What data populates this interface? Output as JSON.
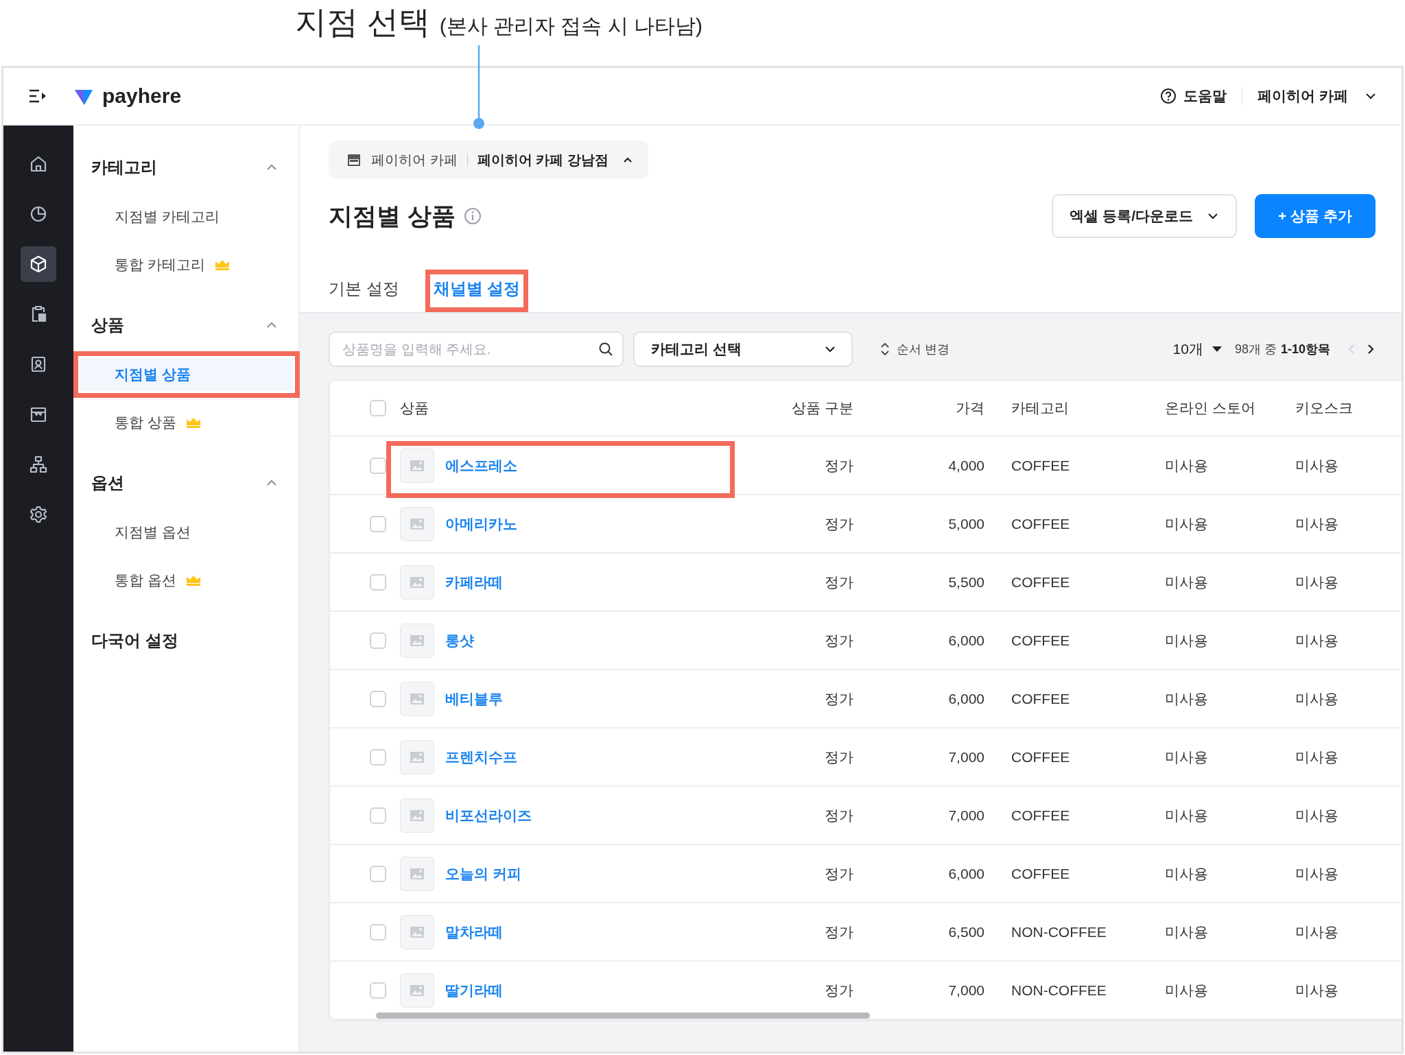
{
  "annotation": {
    "title": "지점 선택",
    "note": "(본사 관리자 접속 시 나타남)"
  },
  "header": {
    "logo": "payhere",
    "help": "도움말",
    "account": "페이히어 카페"
  },
  "rail": [
    {
      "kind": "home",
      "selected": false
    },
    {
      "kind": "chart",
      "selected": false
    },
    {
      "kind": "cube",
      "selected": true
    },
    {
      "kind": "clipboard",
      "selected": false
    },
    {
      "kind": "contact",
      "selected": false
    },
    {
      "kind": "store",
      "selected": false
    },
    {
      "kind": "org",
      "selected": false
    },
    {
      "kind": "settings",
      "selected": false
    }
  ],
  "nav": [
    {
      "kind": "section",
      "title": "카테고리",
      "expanded": true,
      "items": [
        {
          "label": "지점별 카테고리",
          "selected": false,
          "premium": false,
          "highlighted": false
        },
        {
          "label": "통합 카테고리",
          "selected": false,
          "premium": true,
          "highlighted": false
        }
      ]
    },
    {
      "kind": "section",
      "title": "상품",
      "expanded": true,
      "items": [
        {
          "label": "지점별 상품",
          "selected": true,
          "premium": false,
          "highlighted": true
        },
        {
          "label": "통합 상품",
          "selected": false,
          "premium": true,
          "highlighted": false
        }
      ]
    },
    {
      "kind": "section",
      "title": "옵션",
      "expanded": true,
      "items": [
        {
          "label": "지점별 옵션",
          "selected": false,
          "premium": false,
          "highlighted": false
        },
        {
          "label": "통합 옵션",
          "selected": false,
          "premium": true,
          "highlighted": false
        }
      ]
    },
    {
      "kind": "link",
      "title": "다국어 설정"
    }
  ],
  "branch_selector": {
    "company": "페이히어 카페",
    "branch": "페이히어 카페 강남점",
    "expanded": true
  },
  "page_title": "지점별 상품",
  "buttons": {
    "excel": "엑셀 등록/다운로드",
    "add": "+ 상품 추가"
  },
  "tabs": [
    {
      "label": "기본 설정",
      "selected": false,
      "highlighted": false
    },
    {
      "label": "채널별 설정",
      "selected": true,
      "highlighted": true
    }
  ],
  "toolbar": {
    "search_placeholder": "상품명을 입력해 주세요.",
    "category_select": "카테고리 선택",
    "reorder": "순서 변경",
    "page_size": "10개",
    "range_prefix": "98개 중",
    "range": "1-10항목"
  },
  "table": {
    "select_all_checked": false,
    "columns": [
      "상품",
      "상품 구분",
      "가격",
      "카테고리",
      "온라인 스토어",
      "키오스크"
    ],
    "rows": [
      {
        "checked": false,
        "highlighted": true,
        "product": "에스프레소",
        "type": "정가",
        "price": "4,000",
        "category": "COFFEE",
        "online": "미사용",
        "kiosk": "미사용"
      },
      {
        "checked": false,
        "highlighted": false,
        "product": "아메리카노",
        "type": "정가",
        "price": "5,000",
        "category": "COFFEE",
        "online": "미사용",
        "kiosk": "미사용"
      },
      {
        "checked": false,
        "highlighted": false,
        "product": "카페라떼",
        "type": "정가",
        "price": "5,500",
        "category": "COFFEE",
        "online": "미사용",
        "kiosk": "미사용"
      },
      {
        "checked": false,
        "highlighted": false,
        "product": "롱샷",
        "type": "정가",
        "price": "6,000",
        "category": "COFFEE",
        "online": "미사용",
        "kiosk": "미사용"
      },
      {
        "checked": false,
        "highlighted": false,
        "product": "베티블루",
        "type": "정가",
        "price": "6,000",
        "category": "COFFEE",
        "online": "미사용",
        "kiosk": "미사용"
      },
      {
        "checked": false,
        "highlighted": false,
        "product": "프렌치수프",
        "type": "정가",
        "price": "7,000",
        "category": "COFFEE",
        "online": "미사용",
        "kiosk": "미사용"
      },
      {
        "checked": false,
        "highlighted": false,
        "product": "비포선라이즈",
        "type": "정가",
        "price": "7,000",
        "category": "COFFEE",
        "online": "미사용",
        "kiosk": "미사용"
      },
      {
        "checked": false,
        "highlighted": false,
        "product": "오늘의 커피",
        "type": "정가",
        "price": "6,000",
        "category": "COFFEE",
        "online": "미사용",
        "kiosk": "미사용"
      },
      {
        "checked": false,
        "highlighted": false,
        "product": "말차라떼",
        "type": "정가",
        "price": "6,500",
        "category": "NON-COFFEE",
        "online": "미사용",
        "kiosk": "미사용"
      },
      {
        "checked": false,
        "highlighted": false,
        "product": "딸기라떼",
        "type": "정가",
        "price": "7,000",
        "category": "NON-COFFEE",
        "online": "미사용",
        "kiosk": "미사용"
      }
    ]
  }
}
